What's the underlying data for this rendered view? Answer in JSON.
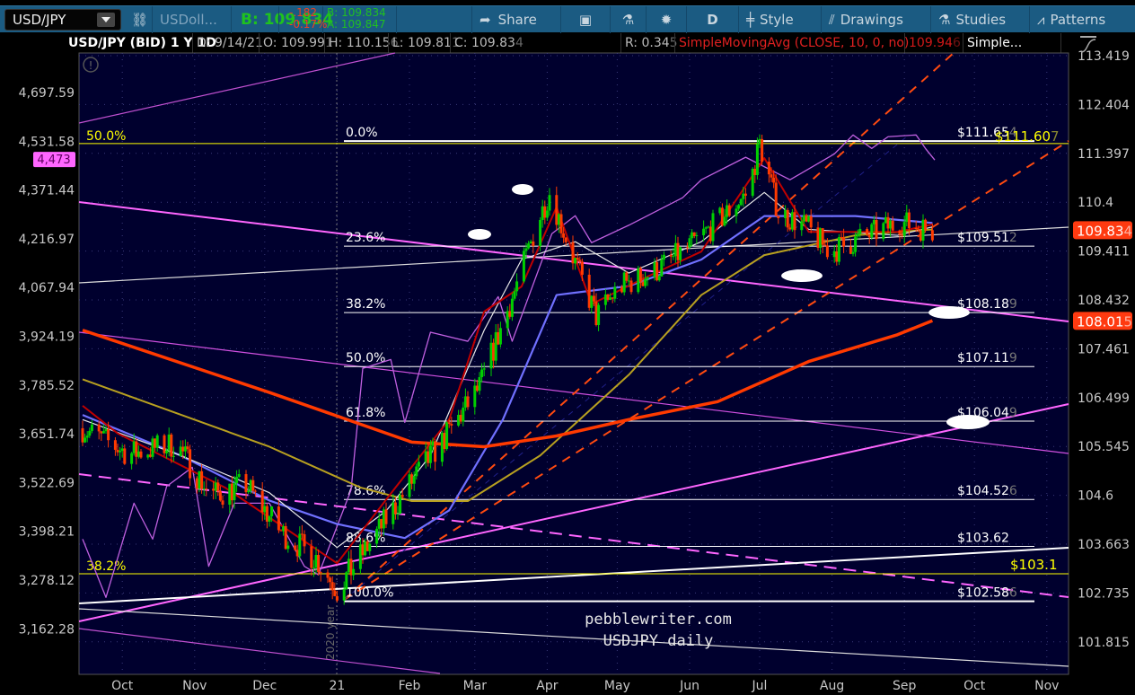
{
  "toolbar": {
    "symbol": "USD/JPY",
    "description": "USDoll...",
    "bid_big": "B: 109.834",
    "change": "-.182",
    "change_pct": "-0.17%",
    "bid": "B: 109.834",
    "ask": "A: 109.847",
    "share": "Share",
    "period": "D",
    "style": "Style",
    "drawings": "Drawings",
    "studies": "Studies",
    "patterns": "Patterns"
  },
  "header": {
    "title": "USD/JPY (BID) 1 Y 1D",
    "date": "D: 9/14/21",
    "open": "O: 109.99",
    "open_sub": "1",
    "high": "H: 110.15",
    "high_sub": "6",
    "low": "L: 109.81",
    "low_sub": "1",
    "close": "C: 109.83",
    "close_sub": "4",
    "range": "R: 0.34",
    "range_sub": "5",
    "study": "SimpleMovingAvg (CLOSE, 10, 0, no)",
    "study_val": "109.94",
    "study_val_sub": "6",
    "study2": "Simple..."
  },
  "colors": {
    "bg": "#00002e",
    "up": "#00d000",
    "down": "#ff3a00",
    "sma10": "#c00000",
    "sma20": "#e8e8e8",
    "sma50": "#7070ff",
    "sma100": "#b8a020",
    "sma200": "#ff3a00",
    "spx": "#c060e0",
    "fib": "#ffffff",
    "yellow": "#ffff00"
  },
  "chart_data": {
    "type": "candlestick",
    "title": "USD/JPY (BID) 1 Y 1D",
    "x_unit": "days since 9/14/20",
    "x_ticks": [
      {
        "label": "Oct",
        "day": 17
      },
      {
        "label": "Nov",
        "day": 48
      },
      {
        "label": "Dec",
        "day": 78
      },
      {
        "label": "21",
        "day": 109
      },
      {
        "label": "Feb",
        "day": 140
      },
      {
        "label": "Mar",
        "day": 168
      },
      {
        "label": "Apr",
        "day": 199
      },
      {
        "label": "May",
        "day": 229
      },
      {
        "label": "Jun",
        "day": 260
      },
      {
        "label": "Jul",
        "day": 290
      },
      {
        "label": "Aug",
        "day": 321
      },
      {
        "label": "Sep",
        "day": 352
      },
      {
        "label": "Oct",
        "day": 382
      },
      {
        "label": "Nov",
        "day": 413
      }
    ],
    "right_axis": [
      "113.419",
      "112.404",
      "111.397",
      "110.4",
      "109.411",
      "108.432",
      "107.461",
      "106.499",
      "105.545",
      "104.6",
      "103.663",
      "102.735",
      "101.815"
    ],
    "left_axis": [
      "4,697.59",
      "4,531.58",
      "4,371.44",
      "4,216.97",
      "4,067.94",
      "3,924.19",
      "3,785.52",
      "3,651.74",
      "3,522.69",
      "3,398.21",
      "3,278.12",
      "3,162.28"
    ],
    "price_badges": [
      {
        "main": "109.83",
        "sub": "4",
        "value": 109.834
      },
      {
        "main": "108.01",
        "sub": "5",
        "value": 108.015
      }
    ],
    "left_badge": {
      "label": "4,473",
      "value": 4473
    },
    "close_path": [
      [
        0,
        105.9
      ],
      [
        20,
        105.4
      ],
      [
        40,
        105.6
      ],
      [
        55,
        104.6
      ],
      [
        70,
        104.8
      ],
      [
        85,
        103.9
      ],
      [
        100,
        103.4
      ],
      [
        109,
        102.8
      ],
      [
        125,
        103.8
      ],
      [
        140,
        104.8
      ],
      [
        155,
        105.7
      ],
      [
        170,
        106.7
      ],
      [
        185,
        108.6
      ],
      [
        195,
        110.0
      ],
      [
        200,
        110.6
      ],
      [
        210,
        109.3
      ],
      [
        220,
        108.1
      ],
      [
        230,
        108.7
      ],
      [
        245,
        109.0
      ],
      [
        260,
        109.5
      ],
      [
        272,
        110.0
      ],
      [
        285,
        110.6
      ],
      [
        290,
        111.6
      ],
      [
        298,
        110.2
      ],
      [
        310,
        109.9
      ],
      [
        320,
        109.4
      ],
      [
        330,
        109.6
      ],
      [
        340,
        109.8
      ],
      [
        350,
        110.0
      ],
      [
        364,
        109.83
      ]
    ],
    "sma10": [
      [
        0,
        106.34
      ],
      [
        15,
        105.8
      ],
      [
        61,
        104.75
      ],
      [
        109,
        103.3
      ],
      [
        134,
        104.75
      ],
      [
        157,
        106.07
      ],
      [
        172,
        108.2
      ],
      [
        188,
        108.7
      ],
      [
        203,
        110.3
      ],
      [
        218,
        108.35
      ],
      [
        242,
        108.9
      ],
      [
        265,
        109.4
      ],
      [
        292,
        111.3
      ],
      [
        311,
        109.8
      ],
      [
        349,
        109.8
      ],
      [
        364,
        109.95
      ]
    ],
    "sma20": [
      [
        0,
        106.07
      ],
      [
        42,
        105.37
      ],
      [
        80,
        104.65
      ],
      [
        109,
        103.6
      ],
      [
        130,
        104.3
      ],
      [
        149,
        105.37
      ],
      [
        172,
        107.83
      ],
      [
        188,
        109.24
      ],
      [
        211,
        109.6
      ],
      [
        234,
        108.97
      ],
      [
        265,
        109.6
      ],
      [
        292,
        110.6
      ],
      [
        311,
        109.85
      ],
      [
        349,
        109.73
      ],
      [
        364,
        109.9
      ]
    ],
    "sma50": [
      [
        0,
        106.16
      ],
      [
        42,
        105.37
      ],
      [
        80,
        104.5
      ],
      [
        109,
        104.05
      ],
      [
        138,
        103.78
      ],
      [
        157,
        104.31
      ],
      [
        180,
        106.07
      ],
      [
        203,
        108.53
      ],
      [
        234,
        108.71
      ],
      [
        265,
        109.24
      ],
      [
        292,
        110.12
      ],
      [
        331,
        110.12
      ],
      [
        364,
        109.98
      ]
    ],
    "sma100": [
      [
        0,
        106.86
      ],
      [
        80,
        105.54
      ],
      [
        119,
        104.75
      ],
      [
        141,
        104.49
      ],
      [
        165,
        104.49
      ],
      [
        196,
        105.37
      ],
      [
        234,
        106.95
      ],
      [
        265,
        108.53
      ],
      [
        292,
        109.33
      ],
      [
        331,
        109.73
      ],
      [
        364,
        109.85
      ]
    ],
    "sma200": [
      [
        0,
        107.83
      ],
      [
        80,
        106.6
      ],
      [
        141,
        105.63
      ],
      [
        172,
        105.54
      ],
      [
        203,
        105.75
      ],
      [
        234,
        106.07
      ],
      [
        272,
        106.42
      ],
      [
        311,
        107.21
      ],
      [
        349,
        107.74
      ],
      [
        364,
        108.02
      ]
    ],
    "spx_compare": [
      [
        0,
        3379
      ],
      [
        10,
        3237
      ],
      [
        22,
        3470
      ],
      [
        30,
        3379
      ],
      [
        36,
        3513
      ],
      [
        47,
        3563
      ],
      [
        54,
        3312
      ],
      [
        65,
        3470
      ],
      [
        80,
        3470
      ],
      [
        95,
        3312
      ],
      [
        101,
        3291
      ],
      [
        115,
        3504
      ],
      [
        120,
        3833
      ],
      [
        132,
        3858
      ],
      [
        138,
        3683
      ],
      [
        149,
        3936
      ],
      [
        165,
        3910
      ],
      [
        178,
        4041
      ],
      [
        184,
        3910
      ],
      [
        201,
        4233
      ],
      [
        211,
        4290
      ],
      [
        218,
        4205
      ],
      [
        234,
        4260
      ],
      [
        257,
        4347
      ],
      [
        265,
        4405
      ],
      [
        284,
        4479
      ],
      [
        303,
        4405
      ],
      [
        322,
        4490
      ],
      [
        330,
        4553
      ],
      [
        338,
        4508
      ],
      [
        345,
        4547
      ],
      [
        357,
        4553
      ],
      [
        361,
        4508
      ],
      [
        365,
        4470
      ]
    ],
    "fib_levels": [
      {
        "pct": "0.0%",
        "price": "$111.65",
        "sub": "4",
        "value": 111.65
      },
      {
        "pct": "23.6%",
        "price": "$109.51",
        "sub": "2",
        "value": 109.51
      },
      {
        "pct": "38.2%",
        "price": "$108.18",
        "sub": "9",
        "value": 108.18
      },
      {
        "pct": "50.0%",
        "price": "$107.11",
        "sub": "9",
        "value": 107.11
      },
      {
        "pct": "61.8%",
        "price": "$106.04",
        "sub": "9",
        "value": 106.04
      },
      {
        "pct": "78.6%",
        "price": "$104.52",
        "sub": "6",
        "value": 104.52
      },
      {
        "pct": "88.6%",
        "price": "$103.62",
        "sub": "",
        "value": 103.62
      },
      {
        "pct": "100.0%",
        "price": "$102.58",
        "sub": "6",
        "value": 102.58
      }
    ],
    "yellow_levels": [
      {
        "pct": "50.0%",
        "price": "$111.60",
        "sub": "7",
        "value": 111.6
      },
      {
        "pct": "38.2%",
        "price": "$103.1",
        "sub": "",
        "value": 103.1
      }
    ],
    "year_marker": "2020 year",
    "watermark": [
      "pebblewriter.com",
      "USDJPY daily"
    ]
  }
}
